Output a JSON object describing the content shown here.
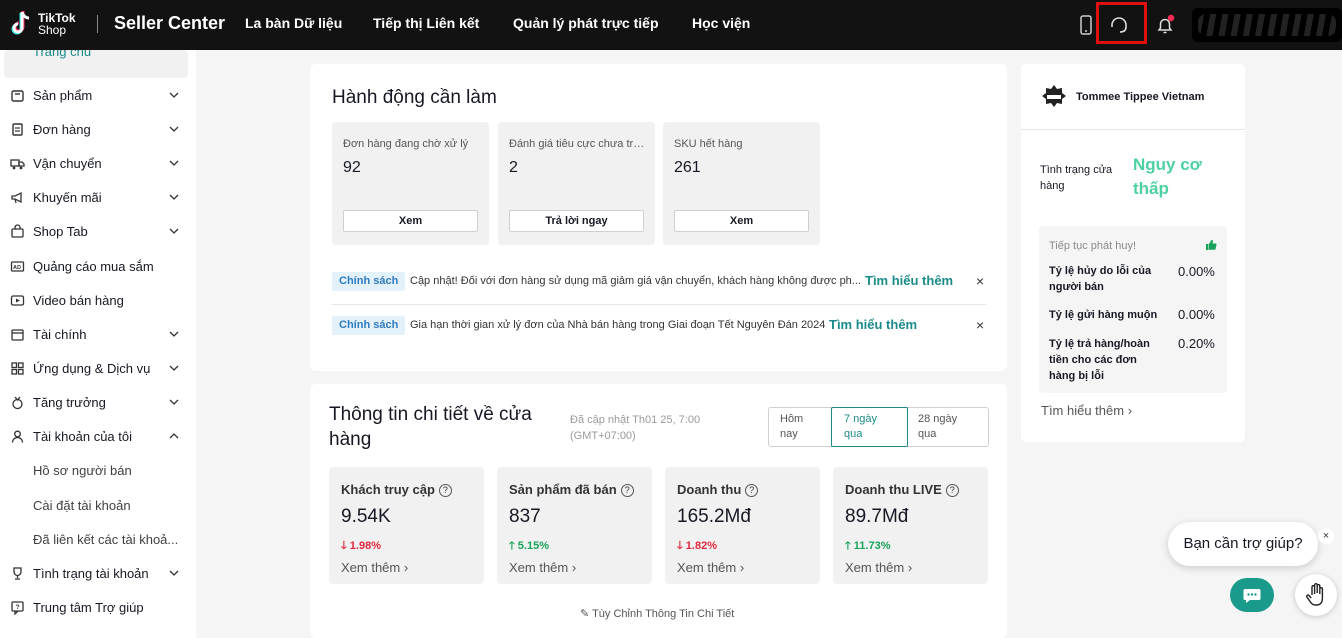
{
  "header": {
    "logo_line1": "TikTok",
    "logo_line2": "Shop",
    "brand": "Seller Center",
    "nav": [
      "La bàn Dữ liệu",
      "Tiếp thị Liên kết",
      "Quản lý phát trực tiếp",
      "Học viện"
    ],
    "icons": [
      "phone-icon",
      "headset-icon",
      "bell-icon"
    ]
  },
  "sidebar": {
    "active_label": "Trang chủ",
    "items": [
      {
        "label": "Sản phẩm",
        "icon": "product-icon",
        "chevron": "down"
      },
      {
        "label": "Đơn hàng",
        "icon": "order-icon",
        "chevron": "down"
      },
      {
        "label": "Vận chuyển",
        "icon": "truck-icon",
        "chevron": "down"
      },
      {
        "label": "Khuyến mãi",
        "icon": "megaphone-icon",
        "chevron": "down"
      },
      {
        "label": "Shop Tab",
        "icon": "shop-bag-icon",
        "chevron": "down"
      },
      {
        "label": "Quảng cáo mua sắm",
        "icon": "ads-icon",
        "chevron": ""
      },
      {
        "label": "Video bán hàng",
        "icon": "video-icon",
        "chevron": ""
      },
      {
        "label": "Tài chính",
        "icon": "finance-icon",
        "chevron": "down"
      },
      {
        "label": "Ứng dụng & Dịch vụ",
        "icon": "apps-icon",
        "chevron": "down"
      },
      {
        "label": "Tăng trưởng",
        "icon": "growth-icon",
        "chevron": "down"
      },
      {
        "label": "Tài khoản của tôi",
        "icon": "user-icon",
        "chevron": "up"
      }
    ],
    "sub_items": [
      "Hồ sơ người bán",
      "Cài đặt tài khoản",
      "Đã liên kết các tài khoả..."
    ],
    "bottom_items": [
      {
        "label": "Tình trạng tài khoản",
        "icon": "trophy-icon",
        "chevron": "down"
      },
      {
        "label": "Trung tâm Trợ giúp",
        "icon": "help-center-icon",
        "chevron": ""
      }
    ]
  },
  "actions": {
    "title": "Hành động cần làm",
    "tiles": [
      {
        "label": "Đơn hàng đang chờ xử lý",
        "value": "92",
        "button": "Xem"
      },
      {
        "label": "Đánh giá tiêu cực chưa trả lời",
        "value": "2",
        "button": "Trả lời ngay"
      },
      {
        "label": "SKU hết hàng",
        "value": "261",
        "button": "Xem"
      }
    ],
    "notices": [
      {
        "tag": "Chính sách",
        "text": "Cập nhật! Đối với đơn hàng sử dụng mã giảm giá vận chuyển, khách hàng không được ph...",
        "link": "Tìm hiểu thêm",
        "close": "×"
      },
      {
        "tag": "Chính sách",
        "text": "Gia hạn thời gian xử lý đơn của Nhà bán hàng trong Giai đoạn Tết Nguyên Đán 2024",
        "link": "Tìm hiểu thêm",
        "close": "×"
      }
    ]
  },
  "insights": {
    "title_line1": "Thông tin chi tiết về cửa",
    "title_line2": "hàng",
    "updated_line1": "Đã cập nhật Th01 25, 7:00",
    "updated_line2": "(GMT+07:00)",
    "periods": [
      {
        "line1": "Hôm",
        "line2": "nay"
      },
      {
        "line1": "7 ngày",
        "line2": "qua"
      },
      {
        "line1": "28 ngày",
        "line2": "qua"
      }
    ],
    "selected_period": "7 ngày qua",
    "metrics": [
      {
        "label": "Khách truy cập",
        "value": "9.54K",
        "delta": "1.98%",
        "direction": "down",
        "more": "Xem thêm"
      },
      {
        "label": "Sản phẩm đã bán",
        "value": "837",
        "delta": "5.15%",
        "direction": "up",
        "more": "Xem thêm"
      },
      {
        "label": "Doanh thu",
        "value": "165.2Mđ",
        "delta": "1.82%",
        "direction": "down",
        "more": "Xem thêm"
      },
      {
        "label": "Doanh thu LIVE",
        "value": "89.7Mđ",
        "delta": "11.73%",
        "direction": "up",
        "more": "Xem thêm"
      }
    ],
    "customize_link": "Tùy Chỉnh Thông Tin Chi Tiết"
  },
  "store": {
    "name": "Tommee Tippee Vietnam",
    "health_label": "Tình trạng cửa hàng",
    "health_value": "Nguy cơ thấp",
    "tip": "Tiếp tục phát huy!",
    "stats": [
      {
        "label": "Tỷ lệ hủy do lỗi của người bán",
        "value": "0.00%"
      },
      {
        "label": "Tỷ lệ gửi hàng muộn",
        "value": "0.00%"
      },
      {
        "label": "Tỷ lệ trả hàng/hoàn tiền cho các đơn hàng bị lỗi",
        "value": "0.20%"
      }
    ],
    "learn_more": "Tìm hiểu thêm"
  },
  "help": {
    "bubble": "Bạn cần trợ giúp?",
    "close": "×"
  },
  "colors": {
    "accent": "#1a8a8a",
    "up": "#17a35a",
    "down": "#e0263c",
    "health": "#4cd1a0",
    "topbar": "#121212"
  }
}
